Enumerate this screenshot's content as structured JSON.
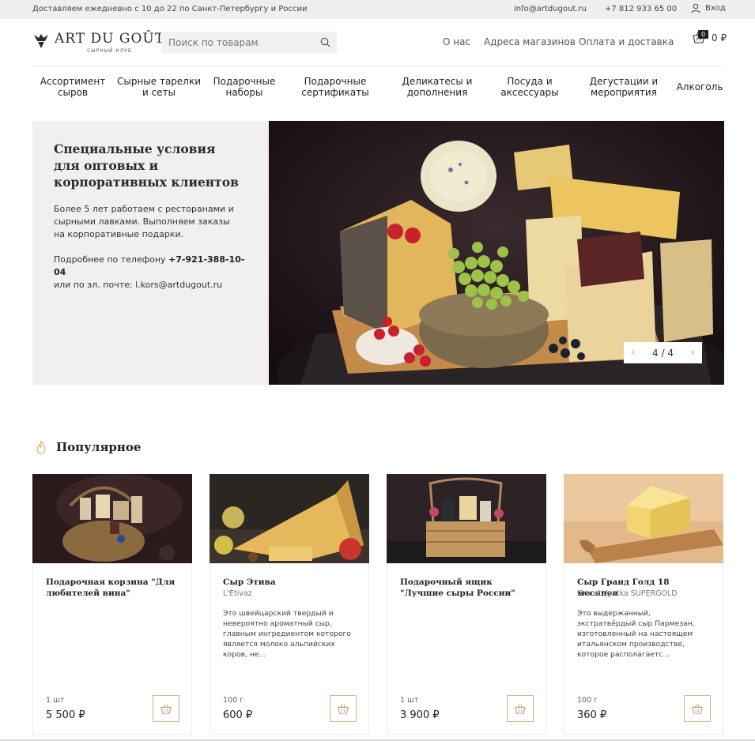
{
  "topbar": {
    "delivery": "Доставляем ежедневно с 10 до 22 по Санкт-Петербургу и России",
    "email": "info@artdugout.ru",
    "phone": "+7 812 933 65 00",
    "login": "Вход",
    "login_icon": "user-icon"
  },
  "header": {
    "logo_text": "ART DU GOÛT",
    "logo_tagline": "СЫРНЫЙ КЛУБ",
    "search_placeholder": "Поиск по товарам",
    "nav": [
      "О нас",
      "Адреса магазинов",
      "Оплата и доставка"
    ],
    "cart_count": "0",
    "cart_total": "0 ₽"
  },
  "categories": [
    "Ассортимент сыров",
    "Сырные тарелки и сеты",
    "Подарочные наборы",
    "Подарочные сертификаты",
    "Деликатесы и дополнения",
    "Посуда и аксессуары",
    "Дегустации и мероприятия",
    "Алкоголь"
  ],
  "hero": {
    "title": "Специальные условия для оптовых и корпоративных клиентов",
    "text": "Более 5 лет работаем с ресторанами и сырными лавками. Выполняем заказы на корпоративные подарки.",
    "contact_phone_prefix": "Подробнее по телефону",
    "contact_phone": "+7-921-388-10-04",
    "contact_email_prefix": "или по эл. почте:",
    "contact_email": "l.kors@artdugout.ru",
    "slide_counter": "4 / 4"
  },
  "popular": {
    "title": "Популярное",
    "products": [
      {
        "name": "Подарочная корзина \"Для любителей вина\"",
        "brand": "",
        "description": "",
        "qty": "1 шт",
        "price": "5 500 ₽"
      },
      {
        "name": "Сыр Этива",
        "brand": "L'Etivaz",
        "description": "Это швейцарский твердый и невероятно ароматный сыр, главным ингредиентом которого является молоко альпийских коров, не...",
        "qty": "100 г",
        "price": "600 ₽"
      },
      {
        "name": "Подарочный ящик \"Лучшие сыры России\"",
        "brand": "",
        "description": "",
        "qty": "1 шт",
        "price": "3 900 ₽"
      },
      {
        "name": "Сыр Гранд Голд 18 месяцев",
        "brand": "Grand Vyatka SUPERGOLD",
        "description": "Это выдержанный, экстратвёрдый сыр Пармезан, изготовленный на настоящем итальянском производстве, которое располагаетс...",
        "qty": "100 г",
        "price": "360 ₽"
      }
    ]
  },
  "colors": {
    "topbar_bg": "#f0efed",
    "hero_panel_bg": "#f1f0ee",
    "buy_border": "#c9b48c",
    "accent": "#e6b26a"
  }
}
